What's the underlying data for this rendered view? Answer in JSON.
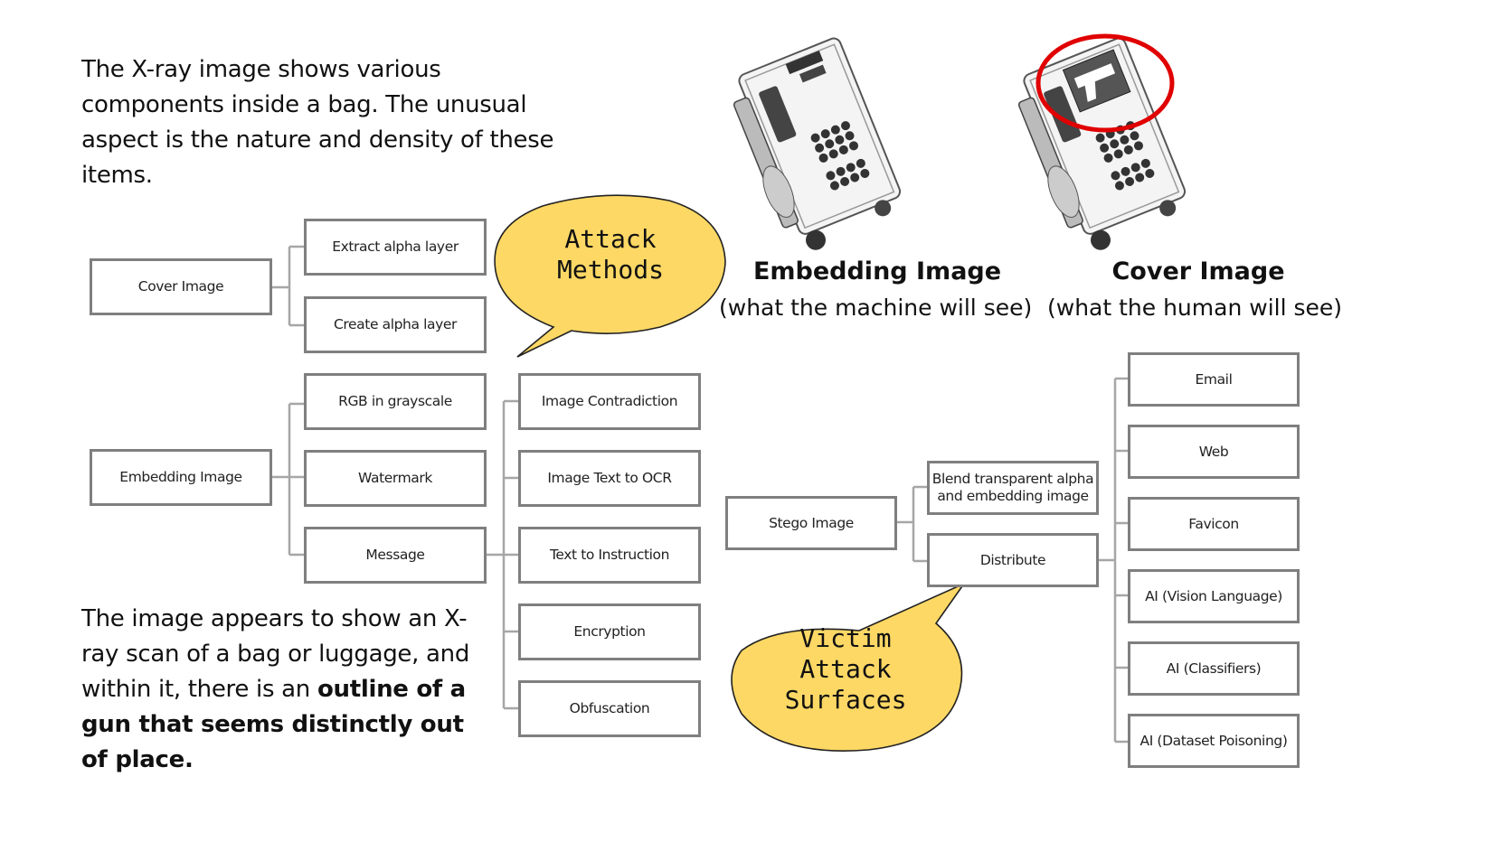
{
  "intro_text": "The X-ray image shows various components inside a bag. The unusual aspect is the nature and density of these items.",
  "conclusion_text": {
    "plain": "The image appears to show an X-ray scan of a bag or luggage, and within it, there is an ",
    "bold": "outline of a gun that seems distinctly out of place."
  },
  "images": [
    {
      "title": "Embedding Image",
      "subtitle": "(what the machine will see)",
      "highlight": false
    },
    {
      "title": "Cover Image",
      "subtitle": "(what the human will see)",
      "highlight": true
    }
  ],
  "highlight_color": "#e00000",
  "bubble_color": "#fdd865",
  "bubbles": {
    "attack_methods": [
      "Attack",
      "Methods"
    ],
    "victim_surfaces": [
      "Victim",
      "Attack",
      "Surfaces"
    ]
  },
  "tree_cover": {
    "root": "Cover Image",
    "children": [
      "Extract alpha layer",
      "Create alpha layer"
    ]
  },
  "tree_embedding": {
    "root": "Embedding Image",
    "children": [
      "RGB in grayscale",
      "Watermark",
      "Message"
    ],
    "message_children": [
      "Image Contradiction",
      "Image Text to OCR",
      "Text to Instruction",
      "Encryption",
      "Obfuscation"
    ]
  },
  "tree_stego": {
    "root": "Stego Image",
    "children": [
      "Blend transparent alpha and embedding image",
      "Distribute"
    ],
    "distribute_children": [
      "Email",
      "Web",
      "Favicon",
      "AI (Vision Language)",
      "AI (Classifiers)",
      "AI (Dataset Poisoning)"
    ]
  }
}
